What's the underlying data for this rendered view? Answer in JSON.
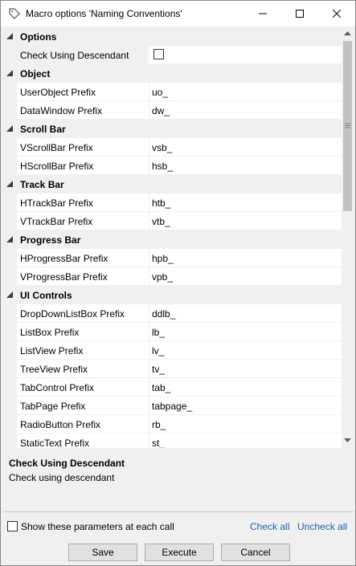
{
  "window": {
    "title": "Macro options 'Naming Conventions'",
    "icon": "tag-icon"
  },
  "grid": {
    "categories": [
      {
        "label": "Options",
        "properties": [
          {
            "name": "Check Using Descendant",
            "type": "checkbox",
            "checked": false,
            "selected": true
          }
        ]
      },
      {
        "label": "Object",
        "properties": [
          {
            "name": "UserObject Prefix",
            "value": "uo_"
          },
          {
            "name": "DataWindow Prefix",
            "value": "dw_"
          }
        ]
      },
      {
        "label": "Scroll Bar",
        "properties": [
          {
            "name": "VScrollBar Prefix",
            "value": "vsb_"
          },
          {
            "name": "HScrollBar Prefix",
            "value": "hsb_"
          }
        ]
      },
      {
        "label": "Track Bar",
        "properties": [
          {
            "name": "HTrackBar Prefix",
            "value": "htb_"
          },
          {
            "name": "VTrackBar Prefix",
            "value": "vtb_"
          }
        ]
      },
      {
        "label": "Progress Bar",
        "properties": [
          {
            "name": "HProgressBar Prefix",
            "value": "hpb_"
          },
          {
            "name": "VProgressBar Prefix",
            "value": "vpb_"
          }
        ]
      },
      {
        "label": "UI Controls",
        "properties": [
          {
            "name": "DropDownListBox Prefix",
            "value": "ddlb_"
          },
          {
            "name": "ListBox Prefix",
            "value": "lb_"
          },
          {
            "name": "ListView Prefix",
            "value": "lv_"
          },
          {
            "name": "TreeView Prefix",
            "value": "tv_"
          },
          {
            "name": "TabControl Prefix",
            "value": "tab_"
          },
          {
            "name": "TabPage Prefix",
            "value": "tabpage_"
          },
          {
            "name": "RadioButton Prefix",
            "value": "rb_"
          },
          {
            "name": "StaticText Prefix",
            "value": "st_"
          }
        ]
      }
    ]
  },
  "description": {
    "title": "Check Using Descendant",
    "text": "Check using descendant"
  },
  "footer": {
    "show_params_label": "Show these parameters at each call",
    "show_params_checked": false,
    "check_all": "Check all",
    "uncheck_all": "Uncheck all",
    "save": "Save",
    "execute": "Execute",
    "cancel": "Cancel"
  }
}
